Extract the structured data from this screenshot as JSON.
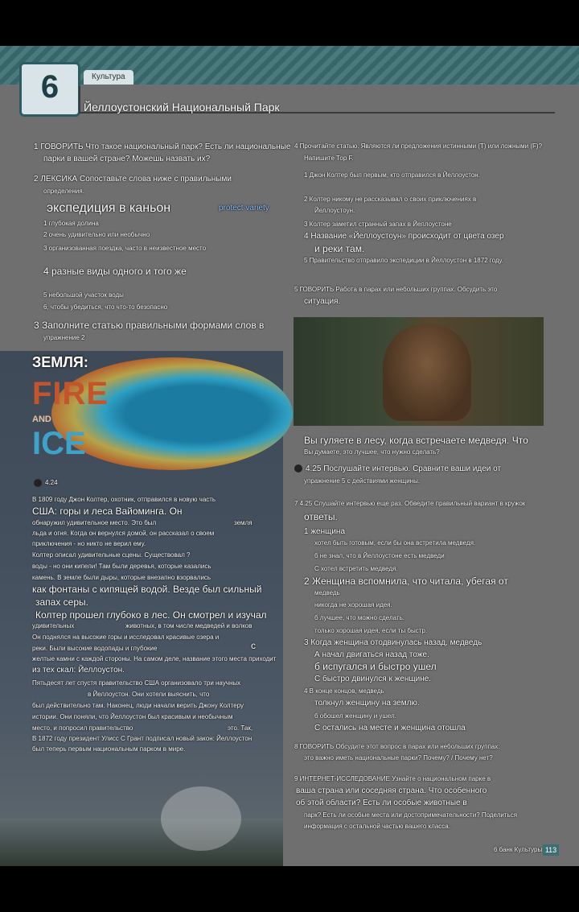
{
  "header": {
    "unit_number": "6",
    "tab_label": "Культура",
    "title": "Йеллоустонский Национальный Парк"
  },
  "left": {
    "q1": "1 ГОВОРИТЬ Что такое национальный парк? Есть ли национальные",
    "q1b": "парки в вашей стране? Можешь назвать их?",
    "q2": "2 ЛЕКСИКА Сопоставьте слова ниже с правильными",
    "q2b": "определения.",
    "words_hint": "protect   variety",
    "big1": "экспедиция в каньон",
    "d1": "1 глубокая долина",
    "d2": "2 очень удивительно или необычно",
    "d3": "3 организованная поездка, часто в неизвестное место",
    "big2": "4 разные виды одного и того же",
    "d5": "5 небольшой участок воды",
    "d6": "6, чтобы убедиться, что что-то безопасно",
    "q3": "3 Заполните статью правильными формами слов в",
    "q3b": "упражнение 2"
  },
  "article": {
    "earth_label": "ЗЕМЛЯ:",
    "fire": "FIRE",
    "and": "AND",
    "ice": "ICE",
    "audio": "4.24",
    "p1": [
      "В 1809 году Джон Колтер, охотник, отправился в новую часть"
    ],
    "p1_big": "США: горы и леса Вайоминга.  Он",
    "p2": [
      "обнаружил удивительное место.  Это был",
      "льда и огня.  Когда он вернулся домой, он рассказал о своем",
      "приключения - но никто не верил ему.",
      "Колтер описал удивительные сцены.  Существовал ?",
      "воды - но они кипели!  Там были деревья, которые казались",
      "камень.  В земле были дыры, которые внезапно взорвались"
    ],
    "p2_big1": "как фонтаны с кипящей водой.  Везде был сильный",
    "p2_big2": "запах серы.",
    "p3_big": "Колтер прошел глубоко в лес.  Он смотрел и изучал",
    "p3": [
      "удивительных",
      "Он поднялся на высокие горы и исследовал красивые озера и",
      "реки.  Были высокие водопады и глубокие",
      "желтые камни с каждой стороны.  На самом деле, название этого места приходит"
    ],
    "p3_c": "с",
    "p3_end": "из тех скал: Йеллоустон.",
    "p4": [
      "Пятьдесят лет спустя правительство США организовало три научных",
      "в Йеллоустон.  Они хотели выяснить, что",
      "был действительно там.  Наконец, люди начали верить Джону Колтеру",
      "истории.  Они поняли, что Йеллоустон был красивым и необычным",
      "место, и попросил правительство",
      "В 1872 году президент Улисс С Грант подписал новый закон: Йеллоустон",
      "был теперь первым национальным парком в мире."
    ],
    "p3_animals": "животных, в том числе медведей и волков",
    "p4_land": "земля",
    "p4_this": "это. Так,"
  },
  "right": {
    "q4": "4 Прочитайте статью.  Являются ли предложения истинными (T) или ложными (F)?",
    "q4b": "Напишите Тор F.",
    "r1": "1 Джон Колтер был первым, кто отправился в Йеллоустон.",
    "r2": "2 Колтер никому не рассказывал о своих приключениях в",
    "r2b": "Йеллоустоун.",
    "r3": "3 Колтер заметил странный запах в Йеллоустоне",
    "r4": "4 Название «Йеллоустоун» происходит от цвета озер",
    "r4b": "и реки там.",
    "r5": "5 Правительство отправило экспедиции в Йеллоустон в 1872 году.",
    "q5": "5 ГОВОРИТЬ Работа в парах или небольших группах.  Обсудить это",
    "q5b": "ситуация.",
    "bear_big": "Вы гуляете в лесу, когда встречаете медведя.  Что",
    "bear_s": "Вы думаете, это лучшее, что нужно сделать?",
    "q6": "4.25 Послушайте интервью.  Сравните ваши идеи от",
    "q6b": "упражнение 5 с действиями женщины.",
    "q7": "7 4.25 Слушайте интервью еще раз.  Обведите правильный вариант в кружок",
    "q7b": "ответы.",
    "a1": "1 женщина",
    "a1a": "хотел быть готовым, если бы она встретила медведя.",
    "a1b": "б не знал, что в Йеллоустоне есть медведи",
    "a1c": "С хотел встретить медведя.",
    "a2": "2 Женщина вспомнила, что читала, убегая от",
    "a2b": "медведь",
    "a2c": "никогда не хорошая идея.",
    "a2d": "б лучшее, что можно сделать.",
    "a2e": "только хорошая идея, если ты быстр.",
    "a3": "3 Когда женщина отодвинулась назад, медведь",
    "a3a": "А начал двигаться назад тоже.",
    "a3b": "б испугался и быстро ушел",
    "a3c": "С быстро двинулся к женщине.",
    "a4": "4 В конце концов, медведь",
    "a4a": "толкнул женщину на землю.",
    "a4b": "б обошел женщину и ушел.",
    "a4c": "С остались на месте и женщина отошла",
    "q8": "8 ГОВОРИТЬ Обсудите этот вопрос в парах или небольших группах:",
    "q8b": "это важно иметь национальные парки?  Почему?  / Почему нет?",
    "q9": "9 ИНТЕРНЕТ-ИССЛЕДОВАНИЕ Узнайте о национальном парке в",
    "q9b": "ваша страна или соседняя страна.  Что особенного",
    "q9c": "об этой области?  Есть ли особые животные в",
    "q9d": "парк?  Есть ли особые места или достопримечательности?  Поделиться",
    "q9e": "информация с остальной частью вашего класса.",
    "footer": "6 банк Культуры",
    "page": "113"
  },
  "colors": {
    "accent": "#3c6f72",
    "speak": "#5fc86a"
  }
}
